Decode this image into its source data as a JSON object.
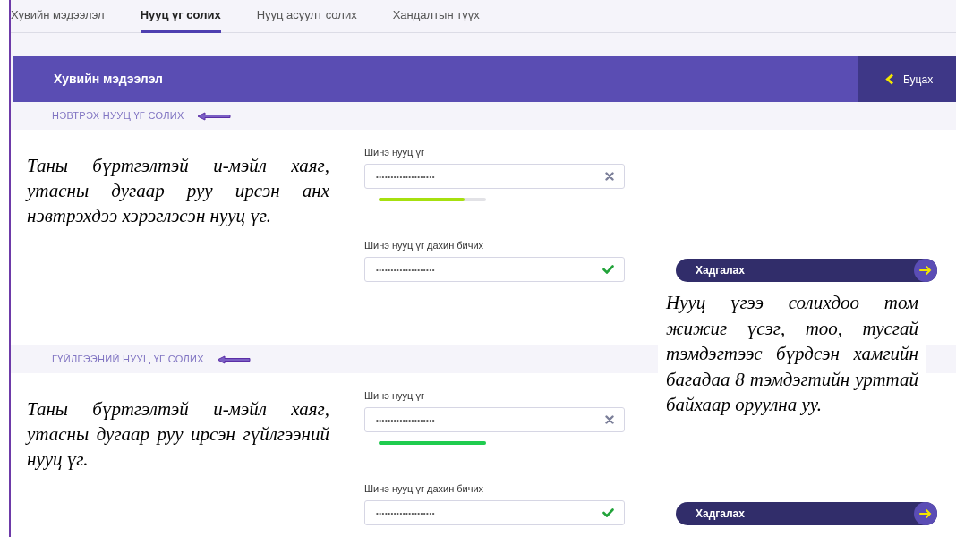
{
  "tabs": [
    {
      "label": "Хувийн мэдээлэл",
      "selected": false
    },
    {
      "label": "Нууц үг солих",
      "selected": true
    },
    {
      "label": "Нууц асуулт солих",
      "selected": false
    },
    {
      "label": "Хандалтын түүх",
      "selected": false
    }
  ],
  "header": {
    "title": "Хувийн мэдээлэл",
    "back_button": "Буцах"
  },
  "sections": [
    {
      "heading": "НЭВТРЭХ НУУЦ ҮГ СОЛИХ",
      "note": "Таны бүртгэлтэй и-мэйл хаяг, утасны дугаар руу  ирсэн анх нэвтрэхдээ хэрэглэсэн нууц үг.",
      "fields": [
        {
          "label": "Шинэ нууц үг",
          "value": "••••••••••••••••••••",
          "kind": "clearable",
          "level": 0.8
        },
        {
          "label": "Шинэ нууц үг дахин бичих",
          "value": "••••••••••••••••••••",
          "kind": "confirmed"
        }
      ],
      "save_button": "Хадгалах"
    },
    {
      "heading": "ГҮЙЛГЭЭНИЙ НУУЦ ҮГ СОЛИХ",
      "note": "Таны бүртгэлтэй и-мэйл хаяг, утасны дугаар руу  ирсэн гүйлгээний нууц үг.",
      "fields": [
        {
          "label": "Шинэ нууц үг",
          "value": "••••••••••••••••••••",
          "kind": "clearable",
          "level": 1
        },
        {
          "label": "Шинэ нууц үг дахин бичих",
          "value": "••••••••••••••••••••",
          "kind": "confirmed"
        }
      ],
      "save_button": "Хадгалах"
    }
  ],
  "tip_note": "Нууц үгээ солихдоо том жижиг үсэг, тоо, тусгай тэмдэгтээс бүрдсэн хамгийн багадаа 8 тэмдэгтийн урттай байхаар оруулна уу."
}
